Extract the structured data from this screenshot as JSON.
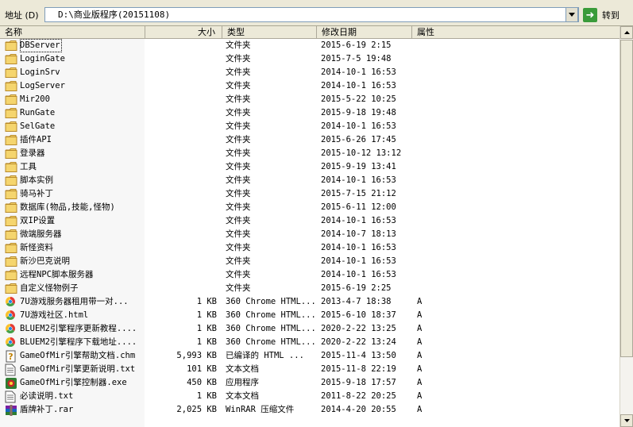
{
  "addressbar": {
    "label": "地址 (D)",
    "path": "D:\\商业版程序(20151108)",
    "go_label": "转到"
  },
  "columns": {
    "name": "名称",
    "size": "大小",
    "type": "类型",
    "date": "修改日期",
    "attr": "属性"
  },
  "files": [
    {
      "name": "DBServer",
      "size": "",
      "type": "文件夹",
      "date": "2015-6-19 2:15",
      "attr": "",
      "icon": "folder-icon"
    },
    {
      "name": "LoginGate",
      "size": "",
      "type": "文件夹",
      "date": "2015-7-5 19:48",
      "attr": "",
      "icon": "folder-icon"
    },
    {
      "name": "LoginSrv",
      "size": "",
      "type": "文件夹",
      "date": "2014-10-1 16:53",
      "attr": "",
      "icon": "folder-icon"
    },
    {
      "name": "LogServer",
      "size": "",
      "type": "文件夹",
      "date": "2014-10-1 16:53",
      "attr": "",
      "icon": "folder-icon"
    },
    {
      "name": "Mir200",
      "size": "",
      "type": "文件夹",
      "date": "2015-5-22 10:25",
      "attr": "",
      "icon": "folder-icon"
    },
    {
      "name": "RunGate",
      "size": "",
      "type": "文件夹",
      "date": "2015-9-18 19:48",
      "attr": "",
      "icon": "folder-icon"
    },
    {
      "name": "SelGate",
      "size": "",
      "type": "文件夹",
      "date": "2014-10-1 16:53",
      "attr": "",
      "icon": "folder-icon"
    },
    {
      "name": "插件API",
      "size": "",
      "type": "文件夹",
      "date": "2015-6-26 17:45",
      "attr": "",
      "icon": "folder-icon"
    },
    {
      "name": "登录器",
      "size": "",
      "type": "文件夹",
      "date": "2015-10-12 13:12",
      "attr": "",
      "icon": "folder-icon"
    },
    {
      "name": "工具",
      "size": "",
      "type": "文件夹",
      "date": "2015-9-19 13:41",
      "attr": "",
      "icon": "folder-icon"
    },
    {
      "name": "脚本实例",
      "size": "",
      "type": "文件夹",
      "date": "2014-10-1 16:53",
      "attr": "",
      "icon": "folder-icon"
    },
    {
      "name": "骑马补丁",
      "size": "",
      "type": "文件夹",
      "date": "2015-7-15 21:12",
      "attr": "",
      "icon": "folder-icon"
    },
    {
      "name": "数据库(物品,技能,怪物)",
      "size": "",
      "type": "文件夹",
      "date": "2015-6-11 12:00",
      "attr": "",
      "icon": "folder-icon"
    },
    {
      "name": "双IP设置",
      "size": "",
      "type": "文件夹",
      "date": "2014-10-1 16:53",
      "attr": "",
      "icon": "folder-icon"
    },
    {
      "name": "微端服务器",
      "size": "",
      "type": "文件夹",
      "date": "2014-10-7 18:13",
      "attr": "",
      "icon": "folder-icon"
    },
    {
      "name": "新怪资料",
      "size": "",
      "type": "文件夹",
      "date": "2014-10-1 16:53",
      "attr": "",
      "icon": "folder-icon"
    },
    {
      "name": "新沙巴克说明",
      "size": "",
      "type": "文件夹",
      "date": "2014-10-1 16:53",
      "attr": "",
      "icon": "folder-icon"
    },
    {
      "name": "远程NPC脚本服务器",
      "size": "",
      "type": "文件夹",
      "date": "2014-10-1 16:53",
      "attr": "",
      "icon": "folder-icon"
    },
    {
      "name": "自定义怪物例子",
      "size": "",
      "type": "文件夹",
      "date": "2015-6-19 2:25",
      "attr": "",
      "icon": "folder-icon"
    },
    {
      "name": "7U游戏服务器租用带一对...",
      "size": "1 KB",
      "type": "360 Chrome HTML...",
      "date": "2013-4-7 18:38",
      "attr": "A",
      "icon": "chrome-html-icon"
    },
    {
      "name": "7U游戏社区.html",
      "size": "1 KB",
      "type": "360 Chrome HTML...",
      "date": "2015-6-10 18:37",
      "attr": "A",
      "icon": "chrome-html-icon"
    },
    {
      "name": "BLUEM2引擎程序更新教程....",
      "size": "1 KB",
      "type": "360 Chrome HTML...",
      "date": "2020-2-22 13:25",
      "attr": "A",
      "icon": "chrome-html-icon"
    },
    {
      "name": "BLUEM2引擎程序下载地址....",
      "size": "1 KB",
      "type": "360 Chrome HTML...",
      "date": "2020-2-22 13:24",
      "attr": "A",
      "icon": "chrome-html-icon"
    },
    {
      "name": "GameOfMir引擎帮助文档.chm",
      "size": "5,993 KB",
      "type": "已编译的 HTML ...",
      "date": "2015-11-4 13:50",
      "attr": "A",
      "icon": "chm-help-icon"
    },
    {
      "name": "GameOfMir引擎更新说明.txt",
      "size": "101 KB",
      "type": "文本文档",
      "date": "2015-11-8 22:19",
      "attr": "A",
      "icon": "text-document-icon"
    },
    {
      "name": "GameOfMir引擎控制器.exe",
      "size": "450 KB",
      "type": "应用程序",
      "date": "2015-9-18 17:57",
      "attr": "A",
      "icon": "application-icon"
    },
    {
      "name": "必读说明.txt",
      "size": "1 KB",
      "type": "文本文档",
      "date": "2011-8-22 20:25",
      "attr": "A",
      "icon": "text-document-icon"
    },
    {
      "name": "盾牌补丁.rar",
      "size": "2,025 KB",
      "type": "WinRAR 压缩文件",
      "date": "2014-4-20 20:55",
      "attr": "A",
      "icon": "winrar-archive-icon"
    }
  ],
  "colors": {
    "folder": "#f5d56e",
    "folder_edge": "#b88a2a",
    "chrome_red": "#e53935",
    "chrome_yellow": "#fbc02d",
    "chrome_green": "#43a047",
    "chrome_blue": "#1e88e5",
    "go_green": "#3a9b3a"
  }
}
